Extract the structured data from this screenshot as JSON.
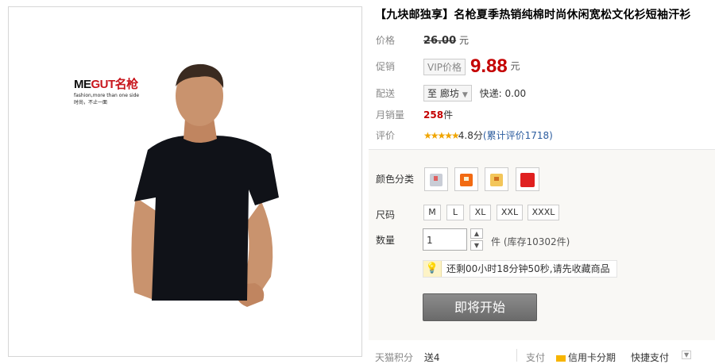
{
  "product": {
    "title": "【九块邮独享】名枪夏季热销纯棉时尚休闲宽松文化衫短袖汗衫",
    "brand_logo": "MEGUT名枪",
    "brand_slogan_en": "fashion,more than one side",
    "brand_slogan_cn": "时尚，不止一面"
  },
  "price": {
    "label": "价格",
    "original": "26.00",
    "unit": "元"
  },
  "promo": {
    "label": "促销",
    "badge": "VIP价格",
    "price": "9.88",
    "unit": "元"
  },
  "delivery": {
    "label": "配送",
    "dest_prefix": "至",
    "destination": "廊坊",
    "express": "快递: 0.00"
  },
  "sales": {
    "label": "月销量",
    "count": "258",
    "unit": "件"
  },
  "rating": {
    "label": "评价",
    "stars": "★★★★★",
    "score": "4.8分",
    "link": "(累计评价1718)"
  },
  "options": {
    "color_label": "颜色分类",
    "colors": [
      {
        "name": "light-gray",
        "hex": "#c9cdd6"
      },
      {
        "name": "orange",
        "hex": "#f26a12"
      },
      {
        "name": "yellow",
        "hex": "#f3c65a"
      },
      {
        "name": "red",
        "hex": "#e02020"
      }
    ],
    "size_label": "尺码",
    "sizes": [
      "M",
      "L",
      "XL",
      "XXL",
      "XXXL"
    ],
    "qty_label": "数量",
    "qty_value": "1",
    "stock_text": "件 (库存10302件)"
  },
  "notice": {
    "text": "还剩00小时18分钟50秒,请先收藏商品"
  },
  "cta": {
    "label": "即将开始"
  },
  "footer": {
    "points_label": "天猫积分",
    "points_value": "送4",
    "pay_label": "支付",
    "card_label": "信用卡分期",
    "quick_label": "快捷支付"
  },
  "colors": {
    "accent_red": "#c40000",
    "link_blue": "#2c5d9f",
    "cta_gray": "#7a7a7a"
  }
}
